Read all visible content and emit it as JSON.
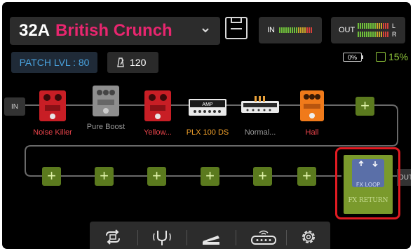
{
  "patch": {
    "number": "32A",
    "name": "British Crunch"
  },
  "meters": {
    "in_label": "IN",
    "out_label": "OUT",
    "left": "L",
    "right": "R"
  },
  "patch_level": "PATCH LVL : 80",
  "tempo": "120",
  "status": {
    "battery": "0%",
    "cpu": "15%"
  },
  "chain": {
    "in_label": "IN",
    "out_label": "OUT",
    "pedals": [
      {
        "name": "Noise Killer",
        "color": "#d21f26",
        "label_color": "#e8434a"
      },
      {
        "name": "Pure Boost",
        "color": "#9a9a9a",
        "label_color": "#9a9a9a"
      },
      {
        "name": "Yellow...",
        "color": "#d21f26",
        "label_color": "#e8434a"
      },
      {
        "name": "PLX 100 DS",
        "color": "#ffffff",
        "label_color": "#f2a12a"
      },
      {
        "name": "Normal...",
        "color": "#ffffff",
        "label_color": "#9a9a9a"
      },
      {
        "name": "Hall",
        "color": "#f07a1a",
        "label_color": "#e8434a"
      }
    ],
    "fx_loop": {
      "title": "FX LOOP",
      "subtitle": "FX RETURN"
    }
  },
  "colors": {
    "accent": "#e8266f",
    "selected": "#e01b22",
    "add_slot": "#5b7a1e",
    "cpu": "#8fc53a",
    "patch_level": "#4aa3df"
  },
  "toolbar": {
    "icons": [
      "loop-icon",
      "tuner-icon",
      "expression-pedal-icon",
      "router-icon",
      "settings-icon"
    ]
  }
}
